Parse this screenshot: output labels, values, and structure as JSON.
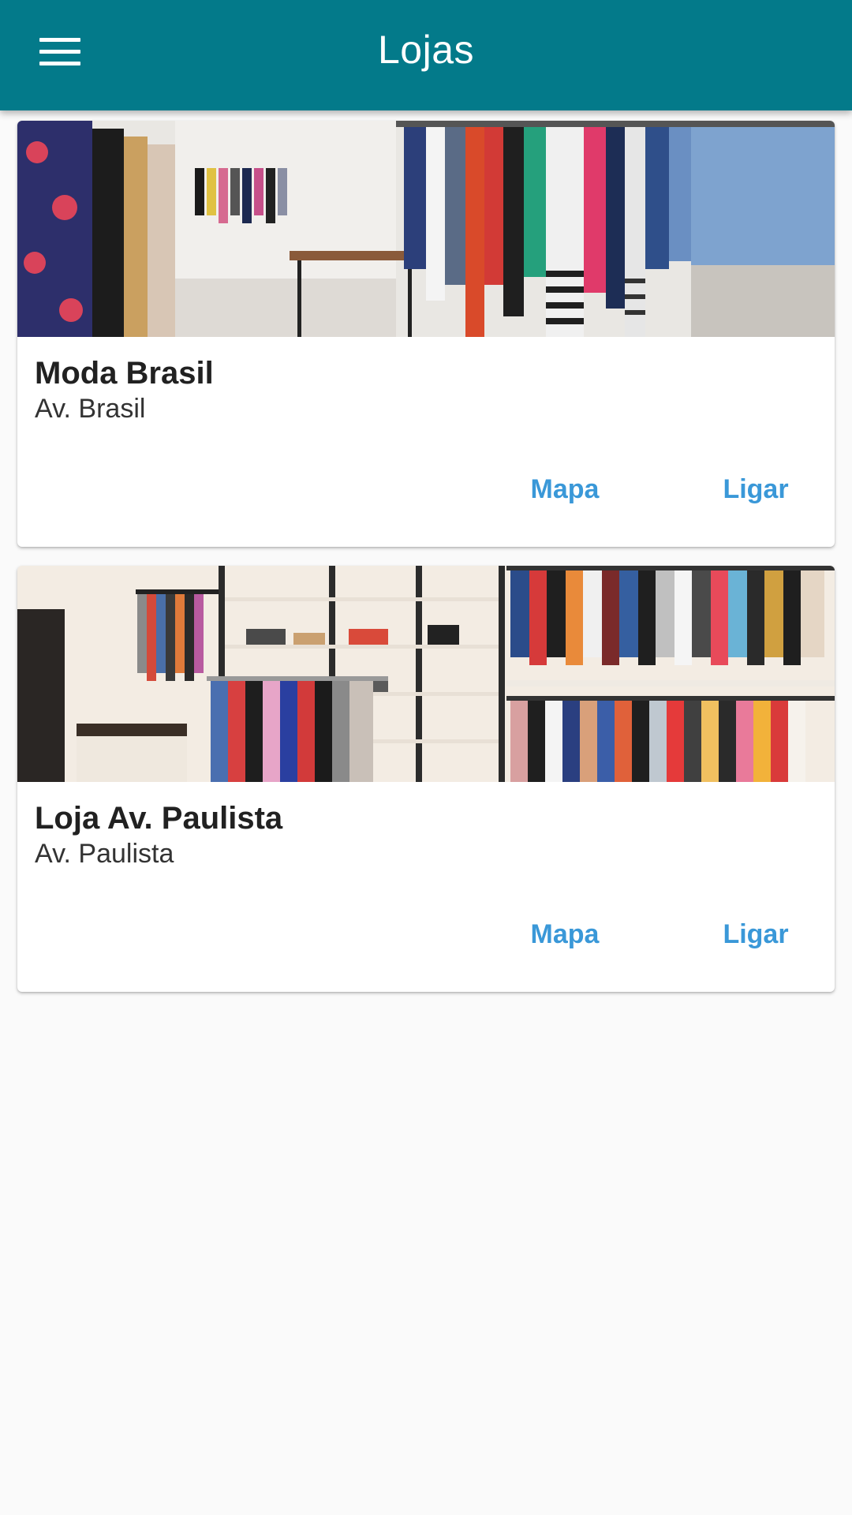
{
  "app_bar": {
    "title": "Lojas",
    "menu_icon": "menu-icon",
    "color": "#037a8a"
  },
  "stores": [
    {
      "name": "Moda Brasil",
      "address": "Av. Brasil",
      "image": "clothing-store-photo",
      "map_label": "Mapa",
      "call_label": "Ligar"
    },
    {
      "name": "Loja Av. Paulista",
      "address": "Av. Paulista",
      "image": "clothing-store-photo",
      "map_label": "Mapa",
      "call_label": "Ligar"
    }
  ],
  "colors": {
    "accent": "#3a98d8",
    "background": "#fafafa",
    "title_text": "#212121"
  }
}
